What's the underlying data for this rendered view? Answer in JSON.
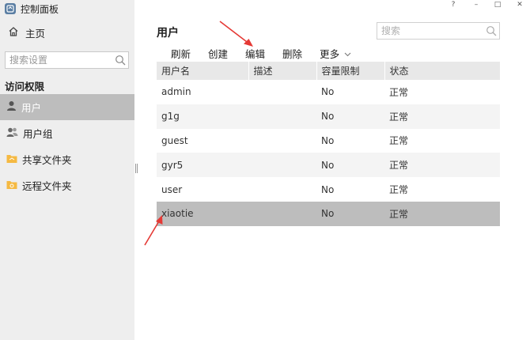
{
  "window": {
    "title": "控制面板",
    "controls": [
      "?",
      "–",
      "□",
      "✕"
    ]
  },
  "sidebar": {
    "home_label": "主页",
    "search_placeholder": "搜索设置",
    "section_title": "访问权限",
    "items": [
      {
        "label": "用户",
        "icon": "user-icon",
        "active": true
      },
      {
        "label": "用户组",
        "icon": "user-group-icon",
        "active": false
      },
      {
        "label": "共享文件夹",
        "icon": "shared-folder-icon",
        "active": false
      },
      {
        "label": "远程文件夹",
        "icon": "remote-folder-icon",
        "active": false
      }
    ]
  },
  "main": {
    "title": "用户",
    "search_placeholder": "搜索",
    "toolbar": {
      "refresh": "刷新",
      "create": "创建",
      "edit": "编辑",
      "delete": "删除",
      "more": "更多"
    },
    "table": {
      "columns": [
        "用户名",
        "描述",
        "容量限制",
        "状态"
      ],
      "rows": [
        {
          "name": "admin",
          "description": "",
          "quota": "No",
          "status": "正常"
        },
        {
          "name": "g1g",
          "description": "",
          "quota": "No",
          "status": "正常"
        },
        {
          "name": "guest",
          "description": "",
          "quota": "No",
          "status": "正常"
        },
        {
          "name": "gyr5",
          "description": "",
          "quota": "No",
          "status": "正常"
        },
        {
          "name": "user",
          "description": "",
          "quota": "No",
          "status": "正常"
        },
        {
          "name": "xiaotie",
          "description": "",
          "quota": "No",
          "status": "正常"
        }
      ],
      "selected_row": 5
    }
  },
  "colors": {
    "sidebar_bg": "#eeeeee",
    "active_bg": "#bdbdbd",
    "header_bg": "#e8e8e8",
    "row_alt_bg": "#f4f4f4",
    "folder_icon": "#f5b942",
    "annotation_arrow": "#e53935"
  }
}
